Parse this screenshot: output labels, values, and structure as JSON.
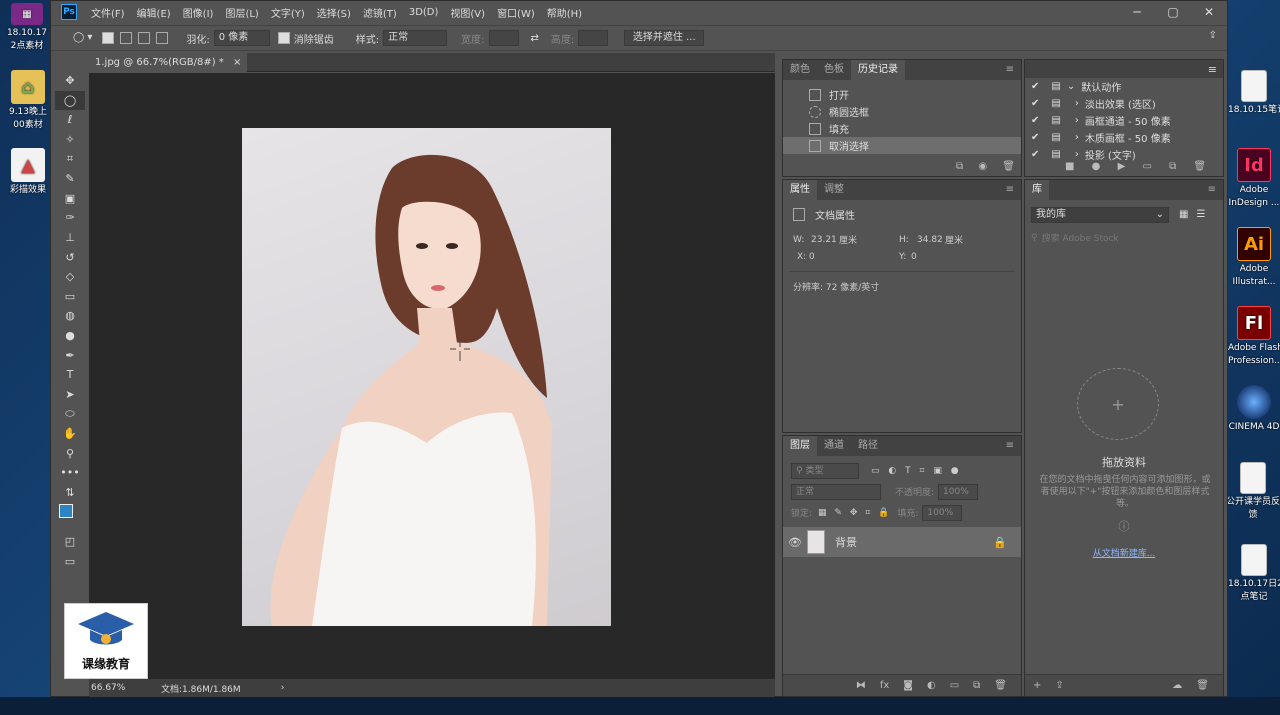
{
  "desktop": {
    "left_icons": [
      {
        "icon": "archive-icon",
        "label": "18.10.17\n2点素材"
      },
      {
        "icon": "folder-icon",
        "label": "9.13晚上\n00素材"
      },
      {
        "icon": "image-icon",
        "label": "彩描效果"
      }
    ],
    "right_icons": [
      {
        "icon": "document-icon",
        "label": "18.10.15笔记"
      },
      {
        "icon": "indesign-icon",
        "glyph": "Id",
        "label": "Adobe\nInDesign ..."
      },
      {
        "icon": "illustrator-icon",
        "glyph": "Ai",
        "label": "Adobe\nIllustrat..."
      },
      {
        "icon": "flash-icon",
        "glyph": "Fl",
        "label": "Adobe Flash\nProfession..."
      },
      {
        "icon": "cinema4d-icon",
        "glyph": "",
        "label": "CINEMA 4D"
      },
      {
        "icon": "document-icon",
        "label": "公开课学员反\n馈"
      },
      {
        "icon": "document-icon",
        "label": "18.10.17日2\n点笔记"
      }
    ]
  },
  "app": {
    "logo": "Ps",
    "menu": [
      "文件(F)",
      "编辑(E)",
      "图像(I)",
      "图层(L)",
      "文字(Y)",
      "选择(S)",
      "滤镜(T)",
      "3D(D)",
      "视图(V)",
      "窗口(W)",
      "帮助(H)"
    ]
  },
  "options": {
    "feather_label": "羽化:",
    "feather_value": "0 像素",
    "antialias_label": "消除锯齿",
    "style_label": "样式:",
    "style_value": "正常",
    "width_label": "宽度:",
    "height_label": "高度:",
    "select_mask": "选择并遮住 ..."
  },
  "document": {
    "tab": "1.jpg @ 66.7%(RGB/8#) *",
    "zoom": "66.67%",
    "docinfo": "文档:1.86M/1.86M"
  },
  "history": {
    "tabs": [
      "颜色",
      "色板",
      "历史记录"
    ],
    "active_tab": 2,
    "items": [
      "打开",
      "椭圆选框",
      "填充",
      "取消选择"
    ]
  },
  "actions": {
    "set": "默认动作",
    "items": [
      "淡出效果 (选区)",
      "画框通道 - 50 像素",
      "木质画框 - 50 像素",
      "投影 (文字)"
    ]
  },
  "properties": {
    "tabs": [
      "属性",
      "调整"
    ],
    "title": "文档属性",
    "w_label": "W:",
    "w_value": "23.21",
    "w_unit": "厘米",
    "h_label": "H:",
    "h_value": "34.82",
    "h_unit": "厘米",
    "x_label": "X:",
    "x_value": "0",
    "y_label": "Y:",
    "y_value": "0",
    "resolution": "分辨率: 72 像素/英寸"
  },
  "layers": {
    "tabs": [
      "图层",
      "通道",
      "路径"
    ],
    "kind": "类型",
    "blend": "正常",
    "opacity_label": "不透明度:",
    "opacity_value": "100%",
    "lock_label": "锁定:",
    "fill_label": "填充:",
    "fill_value": "100%",
    "items": [
      {
        "name": "背景"
      }
    ]
  },
  "library": {
    "tab": "库",
    "name": "我的库",
    "search_placeholder": "搜索 Adobe Stock",
    "drop_title": "拖放资料",
    "drop_desc": "在您的文档中拖曳任何内容可添加图形，或者使用以下\"+\"按钮来添加颜色和图层样式等。",
    "create_link": "从文档新建库..."
  },
  "logo": {
    "text": "课缘教育"
  }
}
